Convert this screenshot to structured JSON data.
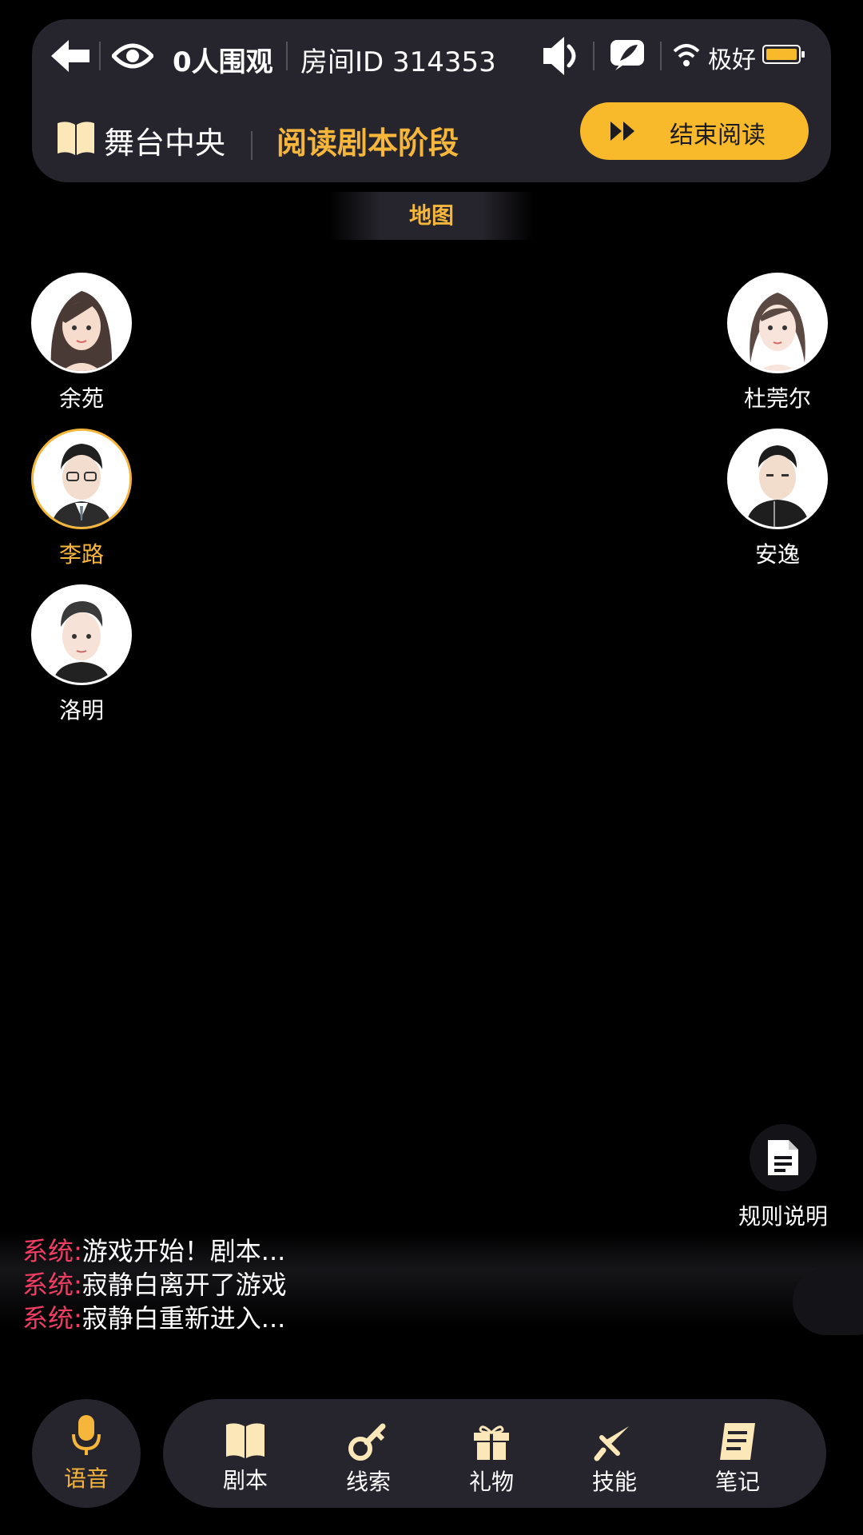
{
  "header": {
    "viewers": "0人围观",
    "room_id": "房间ID 314353",
    "network_status": "极好",
    "stage_label": "舞台中央",
    "phase_label": "阅读剧本阶段",
    "end_button_label": "结束阅读"
  },
  "map_tab": "地图",
  "players": [
    {
      "name": "余苑",
      "active": false
    },
    {
      "name": "李路",
      "active": true
    },
    {
      "name": "洛明",
      "active": false
    },
    {
      "name": "杜莞尔",
      "active": false
    },
    {
      "name": "安逸",
      "active": false
    }
  ],
  "rules_button": "规则说明",
  "chat": [
    {
      "sender": "系统:",
      "text": "游戏开始！剧本..."
    },
    {
      "sender": "系统:",
      "text": "寂静白离开了游戏"
    },
    {
      "sender": "系统:",
      "text": "寂静白重新进入..."
    }
  ],
  "bottom_bar": {
    "voice": "语音",
    "tools": [
      "剧本",
      "线索",
      "礼物",
      "技能",
      "笔记"
    ]
  },
  "colors": {
    "accent": "#f6b63b",
    "button": "#f8ba2b",
    "system": "#ef3d63",
    "panel": "#26242c"
  }
}
